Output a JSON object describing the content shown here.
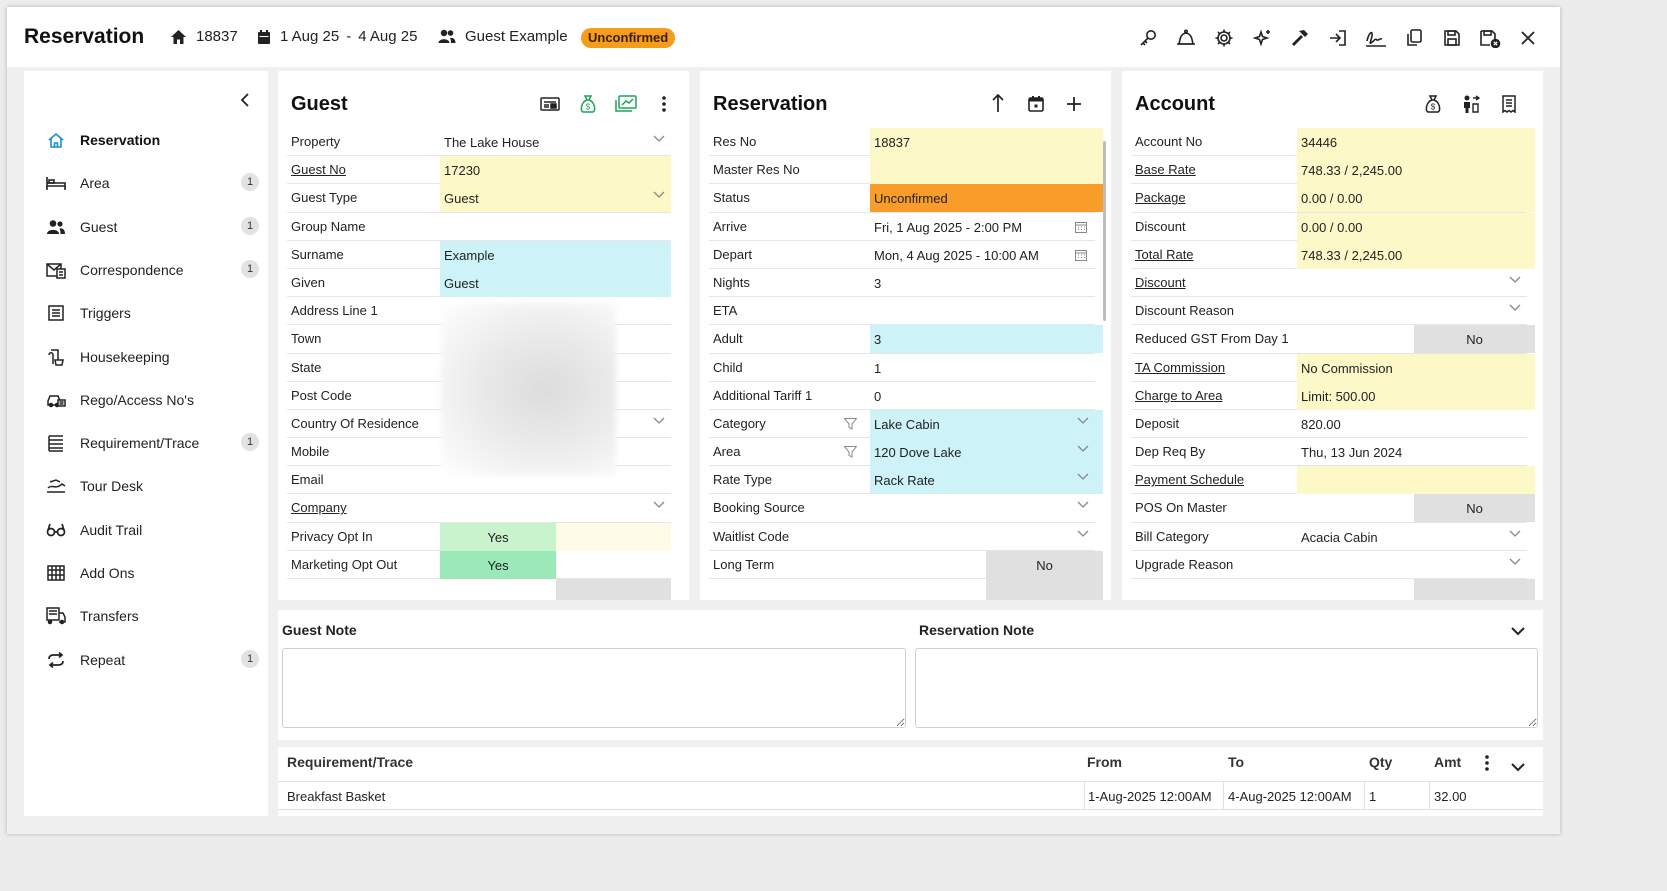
{
  "header": {
    "title": "Reservation",
    "res_no": "18837",
    "date_from": "1 Aug 25",
    "date_sep": "-",
    "date_to": "4 Aug 25",
    "guest": "Guest Example",
    "status": "Unconfirmed"
  },
  "toolbar_icons": [
    "key-icon",
    "bell-icon",
    "gear-icon",
    "sparkle-icon",
    "hammer-icon",
    "sign-in-icon",
    "signature-icon",
    "copy-icon",
    "save-icon",
    "save-close-icon",
    "close-icon"
  ],
  "sidebar": {
    "items": [
      {
        "label": "Reservation",
        "icon": "home-icon",
        "count": ""
      },
      {
        "label": "Area",
        "icon": "bed-icon",
        "count": "1"
      },
      {
        "label": "Guest",
        "icon": "users-icon",
        "count": "1"
      },
      {
        "label": "Correspondence",
        "icon": "mail-icon",
        "count": "1"
      },
      {
        "label": "Triggers",
        "icon": "list-icon",
        "count": ""
      },
      {
        "label": "Housekeeping",
        "icon": "broom-icon",
        "count": ""
      },
      {
        "label": "Rego/Access No's",
        "icon": "car-icon",
        "count": ""
      },
      {
        "label": "Requirement/Trace",
        "icon": "checklist-icon",
        "count": "1"
      },
      {
        "label": "Tour Desk",
        "icon": "tour-icon",
        "count": ""
      },
      {
        "label": "Audit Trail",
        "icon": "glasses-icon",
        "count": ""
      },
      {
        "label": "Add Ons",
        "icon": "grid-icon",
        "count": ""
      },
      {
        "label": "Transfers",
        "icon": "bus-icon",
        "count": ""
      },
      {
        "label": "Repeat",
        "icon": "repeat-icon",
        "count": "1"
      }
    ]
  },
  "guest_panel": {
    "title": "Guest",
    "rows": [
      {
        "label": "Property",
        "value": "The Lake House"
      },
      {
        "label": "Guest No",
        "value": "17230"
      },
      {
        "label": "Guest Type",
        "value": "Guest"
      },
      {
        "label": "Group Name",
        "value": ""
      },
      {
        "label": "Surname",
        "value": "Example"
      },
      {
        "label": "Given",
        "value": "Guest"
      },
      {
        "label": "Address Line 1",
        "value": ""
      },
      {
        "label": "Town",
        "value": ""
      },
      {
        "label": "State",
        "value": ""
      },
      {
        "label": "Post Code",
        "value": ""
      },
      {
        "label": "Country Of Residence",
        "value": ""
      },
      {
        "label": "Mobile",
        "value": ""
      },
      {
        "label": "Email",
        "value": ""
      },
      {
        "label": "Company",
        "value": ""
      },
      {
        "label": "Privacy Opt In",
        "value": "Yes"
      },
      {
        "label": "Marketing Opt Out",
        "value": "Yes"
      },
      {
        "label": "",
        "value": ""
      }
    ]
  },
  "reservation_panel": {
    "title": "Reservation",
    "rows": [
      {
        "label": "Res No",
        "value": "18837"
      },
      {
        "label": "Master Res No",
        "value": ""
      },
      {
        "label": "Status",
        "value": "Unconfirmed"
      },
      {
        "label": "Arrive",
        "value": "Fri, 1 Aug 2025 - 2:00 PM"
      },
      {
        "label": "Depart",
        "value": "Mon, 4 Aug 2025 - 10:00 AM"
      },
      {
        "label": "Nights",
        "value": "3"
      },
      {
        "label": "ETA",
        "value": ""
      },
      {
        "label": "Adult",
        "value": "3"
      },
      {
        "label": "Child",
        "value": "1"
      },
      {
        "label": "Additional Tariff 1",
        "value": "0"
      },
      {
        "label": "Category",
        "value": "Lake Cabin"
      },
      {
        "label": "Area",
        "value": "120 Dove Lake"
      },
      {
        "label": "Rate Type",
        "value": "Rack Rate"
      },
      {
        "label": "Booking Source",
        "value": ""
      },
      {
        "label": "Waitlist Code",
        "value": ""
      },
      {
        "label": "Long Term",
        "value": "No"
      },
      {
        "label": "",
        "value": ""
      }
    ]
  },
  "account_panel": {
    "title": "Account",
    "rows": [
      {
        "label": "Account No",
        "value": "34446"
      },
      {
        "label": "Base Rate",
        "value": "748.33 / 2,245.00"
      },
      {
        "label": "Package",
        "value": "0.00 / 0.00"
      },
      {
        "label": "Discount",
        "value": "0.00 / 0.00"
      },
      {
        "label": "Total Rate",
        "value": "748.33 / 2,245.00"
      },
      {
        "label": "Discount",
        "value": ""
      },
      {
        "label": "Discount Reason",
        "value": ""
      },
      {
        "label": "Reduced GST From Day 1",
        "value": "No"
      },
      {
        "label": "TA Commission",
        "value": "No Commission"
      },
      {
        "label": "Charge to Area",
        "value": "Limit: 500.00"
      },
      {
        "label": "Deposit",
        "value": "820.00"
      },
      {
        "label": "Dep Req By",
        "value": "Thu, 13 Jun 2024"
      },
      {
        "label": "Payment Schedule",
        "value": ""
      },
      {
        "label": "POS On Master",
        "value": "No"
      },
      {
        "label": "Bill Category",
        "value": "Acacia Cabin"
      },
      {
        "label": "Upgrade Reason",
        "value": ""
      },
      {
        "label": "",
        "value": ""
      }
    ]
  },
  "notes": {
    "guest_note_label": "Guest Note",
    "reservation_note_label": "Reservation Note",
    "guest_note": "",
    "reservation_note": ""
  },
  "requirements": {
    "columns": [
      "Requirement/Trace",
      "From",
      "To",
      "Qty",
      "Amt"
    ],
    "rows": [
      {
        "name": "Breakfast Basket",
        "from": "1-Aug-2025 12:00AM",
        "to": "4-Aug-2025 12:00AM",
        "qty": "1",
        "amt": "32.00"
      }
    ]
  },
  "colors": {
    "status_badge": "#f59c1a",
    "highlight_yellow": "#fdf8c8",
    "highlight_cyan": "#cdf2f8",
    "status_orange": "#f89c2a",
    "accent_blue": "#1a8fd6",
    "accent_green": "#1fa35c"
  }
}
